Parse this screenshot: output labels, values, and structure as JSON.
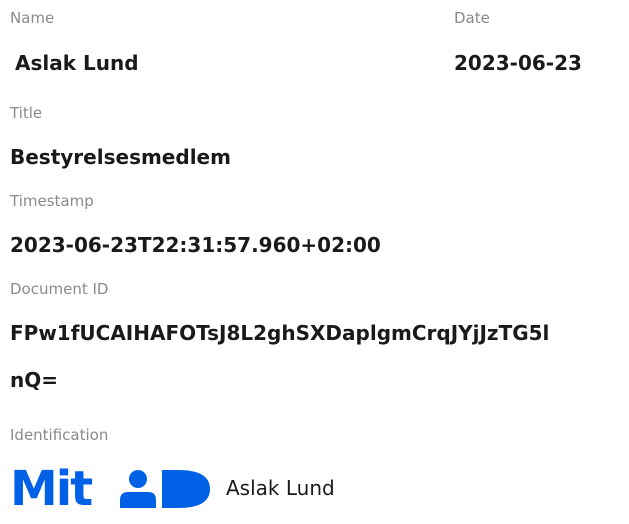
{
  "name": {
    "label": "Name",
    "value": "Aslak Lund"
  },
  "date": {
    "label": "Date",
    "value": "2023-06-23"
  },
  "title": {
    "label": "Title",
    "value": "Bestyrelsesmedlem"
  },
  "timestamp": {
    "label": "Timestamp",
    "value": "2023-06-23T22:31:57.960+02:00"
  },
  "document_id": {
    "label": "Document ID",
    "value_line1": "FPw1fUCAIHAFOTsJ8L2ghSXDaplgmCrqJYjJzTG5l",
    "value_line2": "nQ="
  },
  "identification": {
    "label": "Identification",
    "logo_text": "MitID",
    "logo_icon": "mitid-logo-icon",
    "name": "Aslak Lund"
  },
  "colors": {
    "label": "#8a8a8a",
    "value": "#1a1a1a",
    "brand": "#0060e6"
  }
}
